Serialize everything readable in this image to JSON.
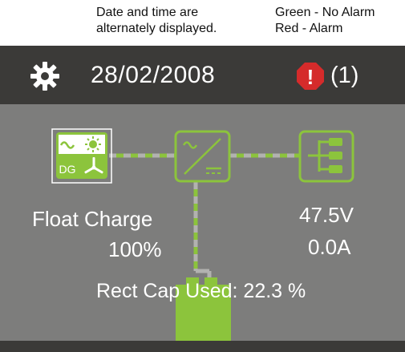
{
  "annotations": {
    "datetime_note_line1": "Date and time are",
    "datetime_note_line2": "alternately displayed.",
    "alarm_note_line1": "Green - No Alarm",
    "alarm_note_line2": "Red - Alarm"
  },
  "header": {
    "date": "28/02/2008",
    "alarm_count": "(1)",
    "alarm_icon_glyph": "!",
    "settings_icon": "gear-icon",
    "alarm_icon": "alarm-icon"
  },
  "system": {
    "ac_source_label": "DG",
    "mode": "Float Charge",
    "battery_percent": "100%",
    "voltage": "47.5V",
    "current": "0.0A",
    "rect_cap_used": "Rect Cap Used: 22.3 %",
    "icons": [
      "ac-source-icon",
      "rectifier-icon",
      "load-distribution-icon",
      "battery-icon"
    ]
  },
  "colors": {
    "screen_bg": "#7d7d7c",
    "bar_bg": "#3b3a38",
    "accent_green": "#8cc43c",
    "alarm_red": "#d52b2b"
  }
}
